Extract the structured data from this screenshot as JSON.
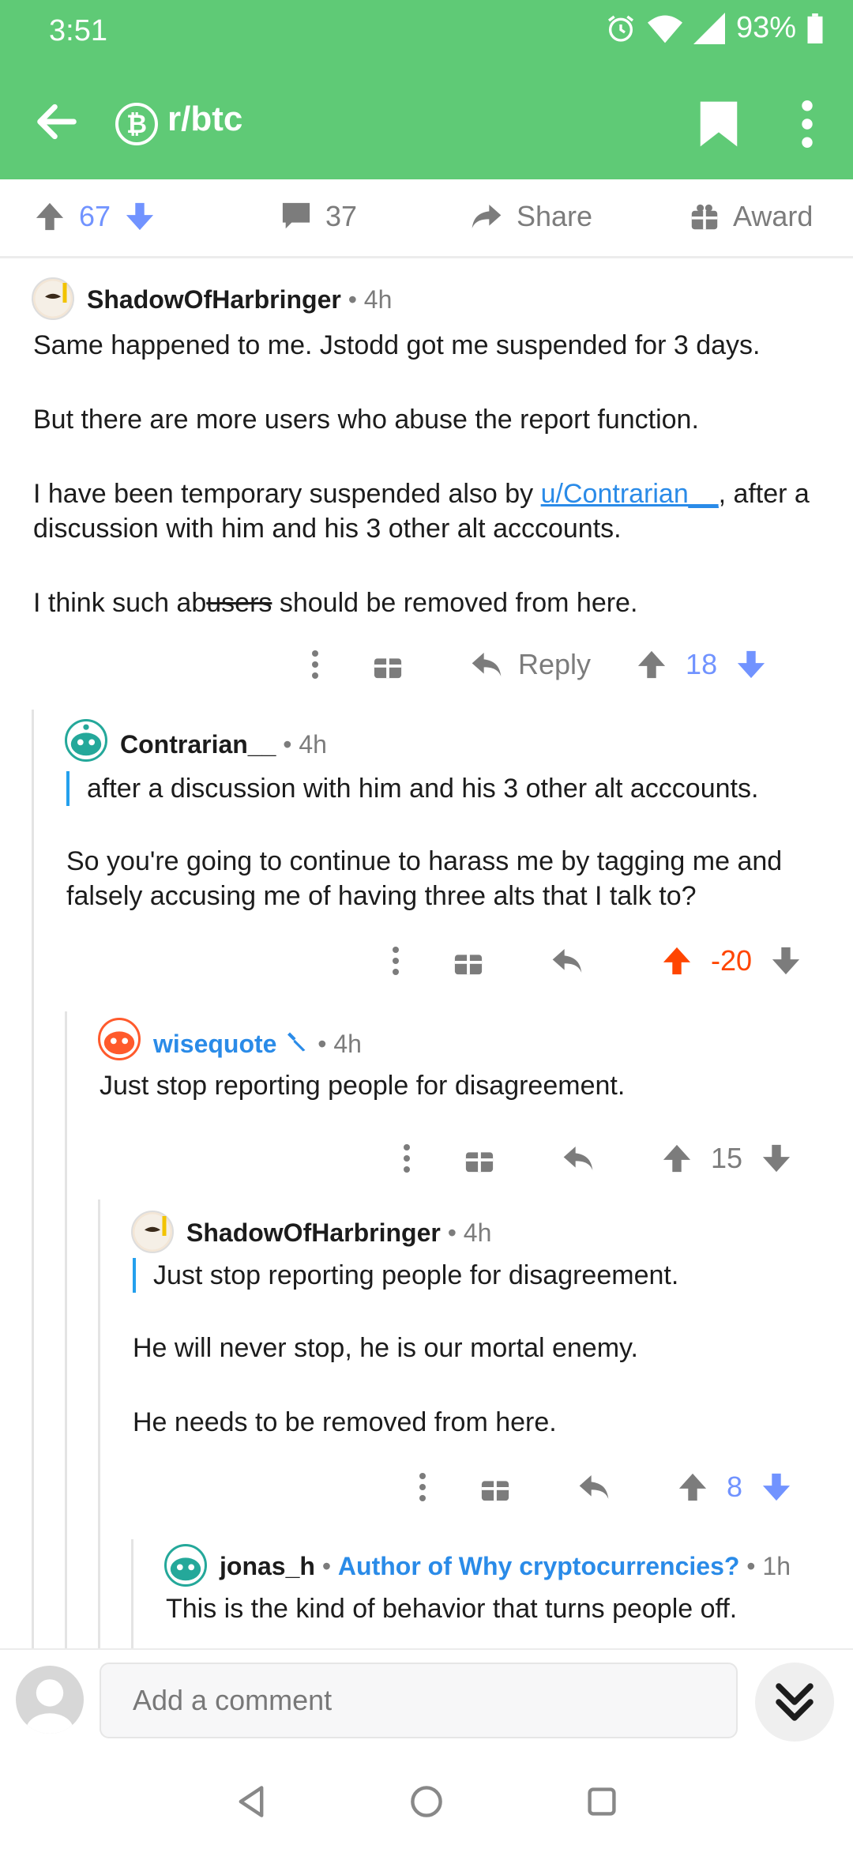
{
  "status": {
    "time": "3:51",
    "battery": "93%"
  },
  "toolbar": {
    "subreddit": "r/btc",
    "subreddit_icon": "bitcoin-icon"
  },
  "actions": {
    "upvotes": "67",
    "comments": "37",
    "share": "Share",
    "award": "Award"
  },
  "comments": [
    {
      "author": "ShadowOfHarbringer",
      "time": "4h",
      "paragraphs": [
        "Same happened to me. Jstodd got me suspended for 3 days.",
        "But there are more users who abuse the report function."
      ],
      "p3_pre": "I have been temporary suspended also by ",
      "p3_link": "u/Contrarian__",
      "p3_post": ", after a discussion with him and his 3 other alt acccounts.",
      "p4_pre": "I think such ab",
      "p4_strike": "users",
      "p4_post": " should be removed from here.",
      "reply": "Reply",
      "score": "18",
      "vote": "none"
    },
    {
      "author": "Contrarian__",
      "time": "4h",
      "quote": "after a discussion with him and his 3 other alt acccounts.",
      "text": "So you're going to continue to harass me by tagging me and falsely accusing me of having three alts that I talk to?",
      "score": "-20",
      "vote": "up"
    },
    {
      "author": "wisequote",
      "time": "4h",
      "text": "Just stop reporting people for disagreement.",
      "score": "15",
      "vote": "none"
    },
    {
      "author": "ShadowOfHarbringer",
      "time": "4h",
      "quote": "Just stop reporting people for disagreement.",
      "text1": "He will never stop, he is our mortal enemy.",
      "text2": "He needs to be removed from here.",
      "score": "8",
      "vote": "none"
    },
    {
      "author": "jonas_h",
      "flair": "Author of Why cryptocurrencies?",
      "time": "1h",
      "text": "This is the kind of behavior that turns people off."
    }
  ],
  "composer": {
    "placeholder": "Add a comment"
  },
  "colors": {
    "header": "#5fca76",
    "upvote": "#ff4500",
    "downvote": "#7193ff",
    "link": "#2a8be8"
  }
}
